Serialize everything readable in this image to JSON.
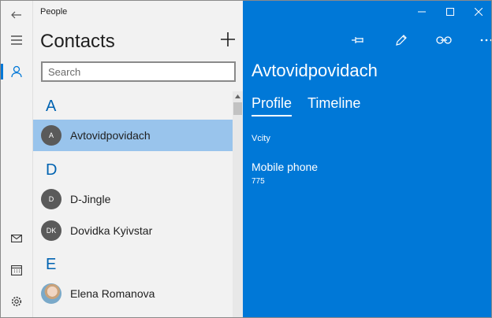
{
  "app": {
    "title": "People"
  },
  "rail": {
    "icons": [
      "back-icon",
      "hamburger-icon",
      "person-icon",
      "mail-icon",
      "calendar-icon",
      "settings-icon"
    ]
  },
  "contacts": {
    "title": "Contacts",
    "search_placeholder": "Search",
    "groups": [
      {
        "letter": "A",
        "items": [
          {
            "initials": "A",
            "name": "Avtovidpovidach",
            "selected": true
          }
        ]
      },
      {
        "letter": "D",
        "items": [
          {
            "initials": "D",
            "name": "D-Jingle"
          },
          {
            "initials": "DK",
            "name": "Dovidka Kyivstar"
          }
        ]
      },
      {
        "letter": "E",
        "items": [
          {
            "initials": "",
            "name": "Elena Romanova"
          }
        ]
      }
    ]
  },
  "detail": {
    "name": "Avtovidpovidach",
    "tabs": [
      "Profile",
      "Timeline"
    ],
    "active_tab": "Profile",
    "city": "Vcity",
    "fields": [
      {
        "label": "Mobile phone",
        "value": "775"
      }
    ]
  },
  "colors": {
    "accent": "#0078d7",
    "selection": "#99c4ec",
    "pane_bg": "#f2f2f2",
    "letter": "#0063b1"
  }
}
